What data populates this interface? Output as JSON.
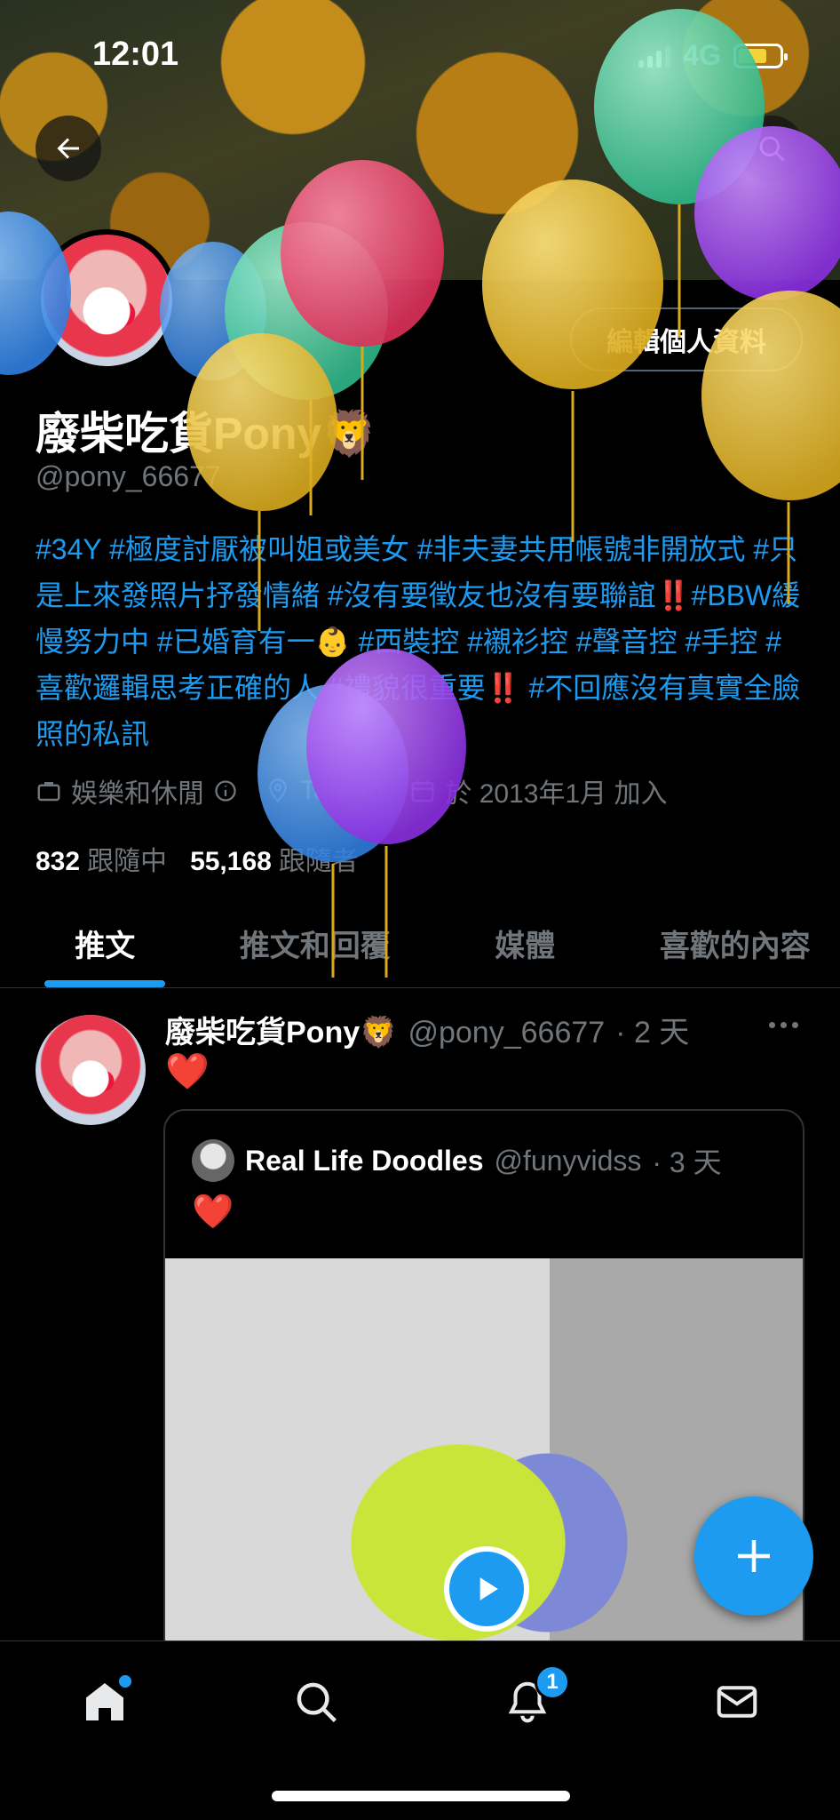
{
  "status_bar": {
    "time": "12:01",
    "network": "4G"
  },
  "profile": {
    "edit_button_label": "編輯個人資料",
    "display_name": "廢柴吃貨Pony🦁",
    "handle": "@pony_66677",
    "bio_segments": [
      "#34Y #極度討厭被叫姐或美女 #非夫妻共用帳號非開放式 #只是上來發照片抒發情緒 #沒有要徵友也沒有要聯誼",
      "‼️",
      "#BBW緩慢努力中 #已婚育有一",
      "👶",
      " #西裝控 #襯衫控 #聲音控 #手控 #喜歡邏輯思考正確的人 #禮貌很重要",
      "‼️",
      " #不回應沒有真實全臉照的私訊"
    ],
    "category": "娛樂和休閒",
    "location": "Taiwan",
    "joined": "於 2013年1月 加入",
    "following_count": "832",
    "following_label": "跟隨中",
    "followers_count": "55,168",
    "followers_label": "跟隨者"
  },
  "tabs": [
    {
      "label": "推文",
      "active": true
    },
    {
      "label": "推文和回覆",
      "active": false
    },
    {
      "label": "媒體",
      "active": false
    },
    {
      "label": "喜歡的內容",
      "active": false
    }
  ],
  "tweet": {
    "name": "廢柴吃貨Pony🦁",
    "handle": "@pony_66677",
    "time": "· 2 天",
    "text": "❤️",
    "quote": {
      "name": "Real Life Doodles",
      "handle": "@funyvidss",
      "time": "· 3 天",
      "text": "❤️"
    }
  },
  "bottom_nav": {
    "notifications_badge": "1"
  },
  "colors": {
    "accent": "#1d9bf0",
    "background": "#000000",
    "secondary_text": "#71767b"
  },
  "icons": {
    "back": "arrow-left-icon",
    "search": "search-icon",
    "home": "home-icon",
    "notifications": "bell-icon",
    "messages": "mail-icon",
    "compose": "plus-icon"
  }
}
